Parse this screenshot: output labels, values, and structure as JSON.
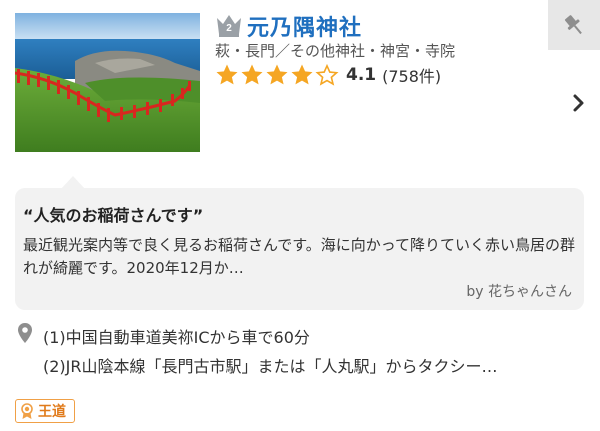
{
  "spot": {
    "rank_number": "2",
    "title": "元乃隅神社",
    "category": "萩・長門／その他神社・神宮・寺院",
    "rating_value": 4.1,
    "rating_text": "4.1",
    "review_count": "(758件)",
    "image_alt": "元乃隅神社 red torii gates along coastal cliff"
  },
  "review": {
    "title": "“人気のお稲荷さんです”",
    "body": "最近観光案内等で良く見るお稲荷さんです。海に向かって降りていく赤い鳥居の群れが綺麗です。2020年12月か…",
    "author": "by 花ちゃんさん"
  },
  "access": {
    "lines": [
      "(1)中国自動車道美祢ICから車で60分",
      "(2)JR山陰本線「長門古市駅」または「人丸駅」からタクシー…"
    ]
  },
  "badge": {
    "label": "王道"
  },
  "icons": {
    "rank": "crown-icon",
    "pin": "pushpin-icon",
    "next": "chevron-right-icon",
    "location": "map-pin-icon",
    "badge": "medal-icon"
  },
  "colors": {
    "title": "#1f6fbf",
    "star": "#f5a623",
    "badge": "#f0a046"
  }
}
